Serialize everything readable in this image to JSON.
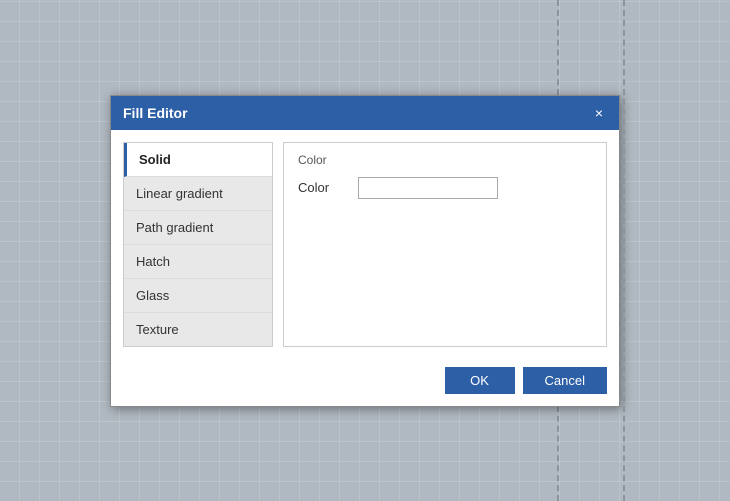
{
  "dialog": {
    "title": "Fill Editor",
    "close_label": "×"
  },
  "fill_types": [
    {
      "id": "solid",
      "label": "Solid",
      "active": true
    },
    {
      "id": "linear-gradient",
      "label": "Linear gradient",
      "active": false
    },
    {
      "id": "path-gradient",
      "label": "Path gradient",
      "active": false
    },
    {
      "id": "hatch",
      "label": "Hatch",
      "active": false
    },
    {
      "id": "glass",
      "label": "Glass",
      "active": false
    },
    {
      "id": "texture",
      "label": "Texture",
      "active": false
    }
  ],
  "content": {
    "section_title": "Color",
    "color_label": "Color",
    "color_value": ""
  },
  "footer": {
    "ok_label": "OK",
    "cancel_label": "Cancel"
  }
}
